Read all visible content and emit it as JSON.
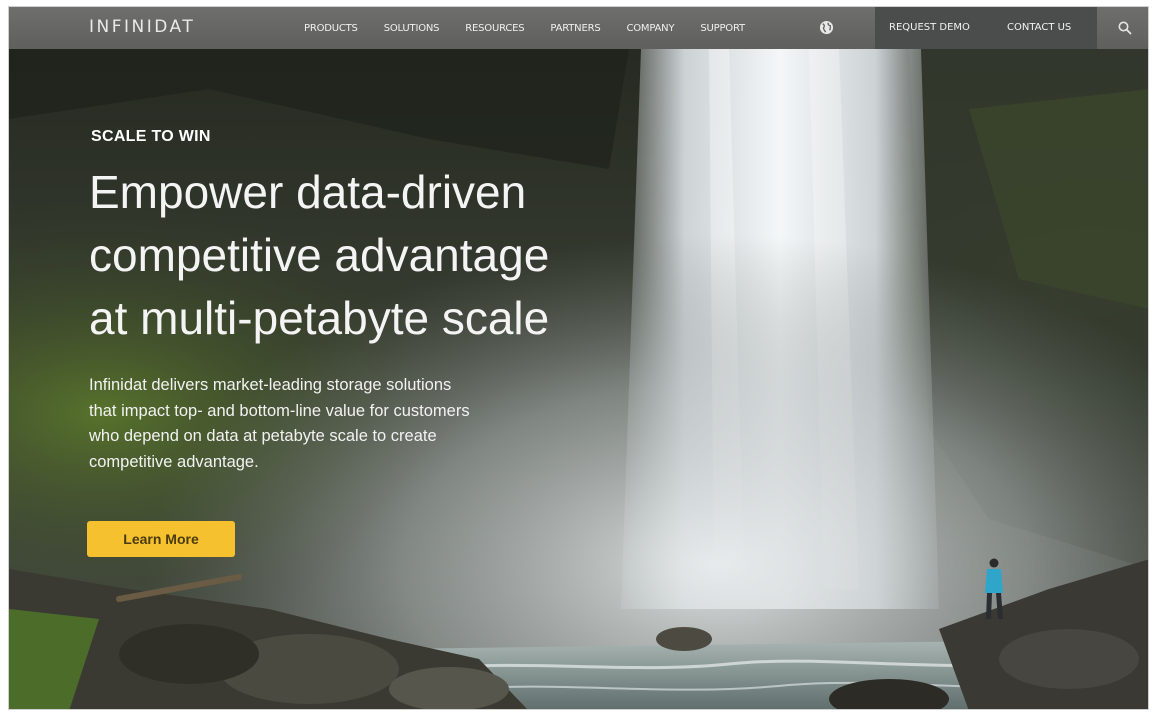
{
  "nav": {
    "logo": "INFINIDAT",
    "links": [
      {
        "label": "PRODUCTS"
      },
      {
        "label": "SOLUTIONS"
      },
      {
        "label": "RESOURCES"
      },
      {
        "label": "PARTNERS"
      },
      {
        "label": "COMPANY"
      },
      {
        "label": "SUPPORT"
      }
    ],
    "globe_icon": "globe-icon",
    "request_demo": "REQUEST DEMO",
    "contact_us": "CONTACT US",
    "search_icon": "search-icon"
  },
  "hero": {
    "eyebrow": "SCALE TO WIN",
    "headline_lines": [
      "Empower data-driven",
      "competitive advantage",
      "at multi-petabyte scale"
    ],
    "body_lines": [
      "Infinidat delivers market-leading storage solutions",
      "that impact top- and bottom-line value for customers",
      "who depend on data at petabyte scale to create",
      "competitive advantage."
    ],
    "cta_label": "Learn More",
    "cta_color": "#f5c12e"
  }
}
